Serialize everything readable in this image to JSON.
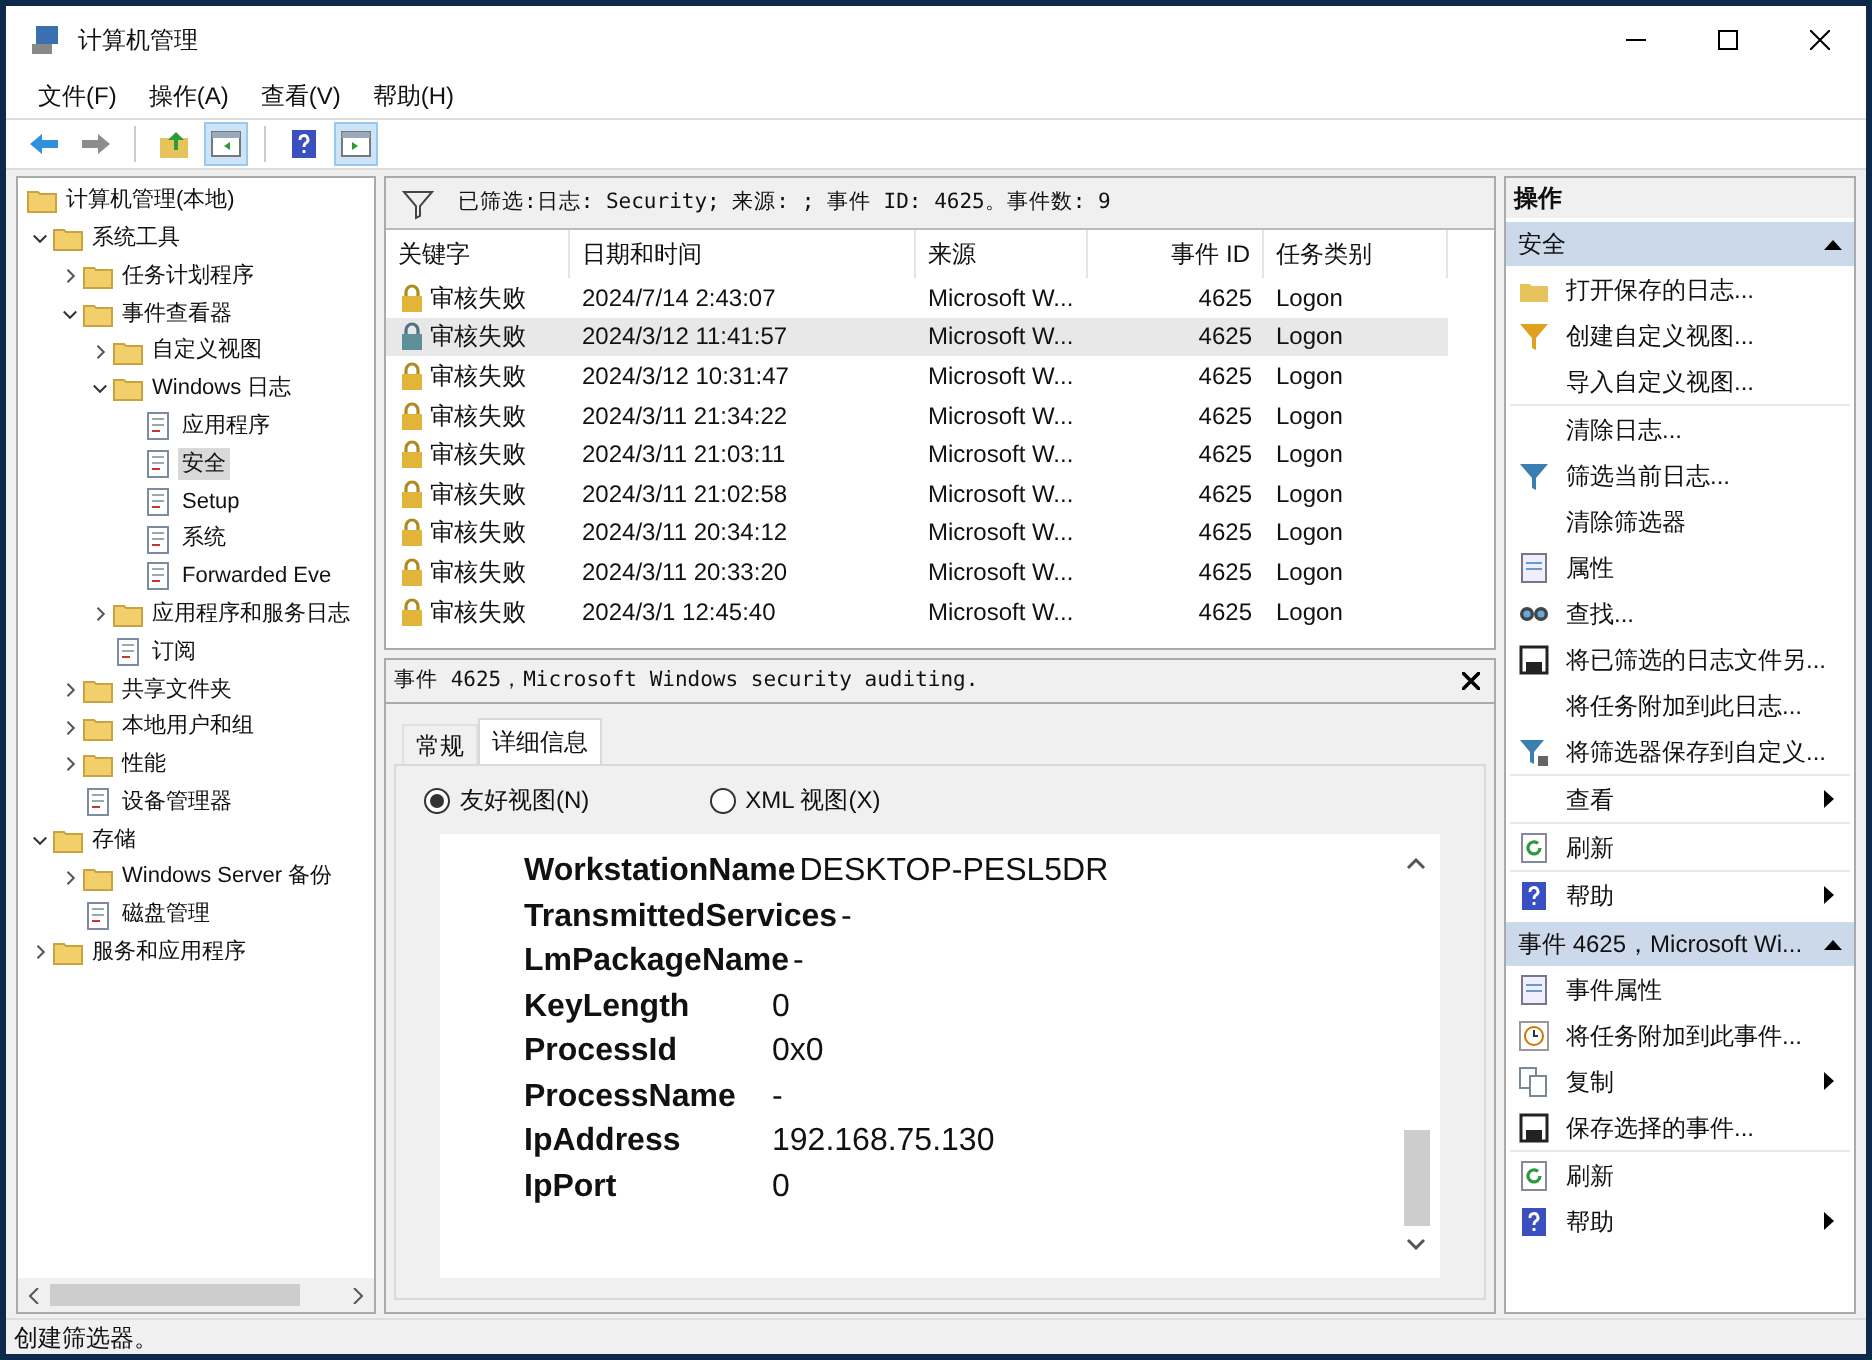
{
  "window": {
    "title": "计算机管理"
  },
  "menu": [
    "文件(F)",
    "操作(A)",
    "查看(V)",
    "帮助(H)"
  ],
  "toolbar": [
    {
      "pressed": false
    },
    {
      "pressed": false
    },
    {
      "pressed": false
    },
    {
      "pressed": true
    },
    {
      "pressed": false
    },
    {
      "pressed": true
    }
  ],
  "tree": [
    {
      "label": "计算机管理(本地)",
      "selected": false,
      "children": [
        {
          "label": "系统工具",
          "selected": false,
          "expanded": true,
          "children": [
            {
              "label": "任务计划程序",
              "selected": false,
              "expanded": false
            },
            {
              "label": "事件查看器",
              "selected": false,
              "expanded": true,
              "children": [
                {
                  "label": "自定义视图",
                  "selected": false,
                  "expanded": false
                },
                {
                  "label": "Windows 日志",
                  "selected": false,
                  "expanded": true,
                  "children": [
                    {
                      "label": "应用程序",
                      "selected": false
                    },
                    {
                      "label": "安全",
                      "selected": true
                    },
                    {
                      "label": "Setup",
                      "selected": false
                    },
                    {
                      "label": "系统",
                      "selected": false
                    },
                    {
                      "label": "Forwarded Eve",
                      "selected": false
                    }
                  ]
                },
                {
                  "label": "应用程序和服务日志",
                  "selected": false,
                  "expanded": false
                },
                {
                  "label": "订阅",
                  "selected": false
                }
              ]
            },
            {
              "label": "共享文件夹",
              "selected": false,
              "expanded": false
            },
            {
              "label": "本地用户和组",
              "selected": false,
              "expanded": false
            },
            {
              "label": "性能",
              "selected": false,
              "expanded": false
            },
            {
              "label": "设备管理器",
              "selected": false
            }
          ]
        },
        {
          "label": "存储",
          "selected": false,
          "expanded": true,
          "children": [
            {
              "label": "Windows Server 备份",
              "selected": false,
              "expanded": false
            },
            {
              "label": "磁盘管理",
              "selected": false
            }
          ]
        },
        {
          "label": "服务和应用程序",
          "selected": false,
          "expanded": false
        }
      ]
    }
  ],
  "filter_bar": "已筛选:日志: Security; 来源: ; 事件 ID: 4625。事件数: 9",
  "table": {
    "columns": [
      "关键字",
      "日期和时间",
      "来源",
      "事件 ID",
      "任务类别"
    ],
    "rows": [
      {
        "keyword": "审核失败",
        "datetime": "2024/7/14 2:43:07",
        "source": "Microsoft W...",
        "event_id": "4625",
        "category": "Logon",
        "selected": false
      },
      {
        "keyword": "审核失败",
        "datetime": "2024/3/12 11:41:57",
        "source": "Microsoft W...",
        "event_id": "4625",
        "category": "Logon",
        "selected": true
      },
      {
        "keyword": "审核失败",
        "datetime": "2024/3/12 10:31:47",
        "source": "Microsoft W...",
        "event_id": "4625",
        "category": "Logon",
        "selected": false
      },
      {
        "keyword": "审核失败",
        "datetime": "2024/3/11 21:34:22",
        "source": "Microsoft W...",
        "event_id": "4625",
        "category": "Logon",
        "selected": false
      },
      {
        "keyword": "审核失败",
        "datetime": "2024/3/11 21:03:11",
        "source": "Microsoft W...",
        "event_id": "4625",
        "category": "Logon",
        "selected": false
      },
      {
        "keyword": "审核失败",
        "datetime": "2024/3/11 21:02:58",
        "source": "Microsoft W...",
        "event_id": "4625",
        "category": "Logon",
        "selected": false
      },
      {
        "keyword": "审核失败",
        "datetime": "2024/3/11 20:34:12",
        "source": "Microsoft W...",
        "event_id": "4625",
        "category": "Logon",
        "selected": false
      },
      {
        "keyword": "审核失败",
        "datetime": "2024/3/11 20:33:20",
        "source": "Microsoft W...",
        "event_id": "4625",
        "category": "Logon",
        "selected": false
      },
      {
        "keyword": "审核失败",
        "datetime": "2024/3/1 12:45:40",
        "source": "Microsoft W...",
        "event_id": "4625",
        "category": "Logon",
        "selected": false
      }
    ]
  },
  "details": {
    "title": "事件 4625，Microsoft Windows security auditing.",
    "tabs": [
      {
        "label": "常规",
        "selected": false
      },
      {
        "label": "详细信息",
        "selected": true
      }
    ],
    "views": [
      {
        "label": "友好视图(N)",
        "selected": true
      },
      {
        "label": "XML 视图(X)",
        "selected": false
      }
    ],
    "fields": [
      {
        "name": "WorkstationName",
        "value": "DESKTOP-PESL5DR"
      },
      {
        "name": "TransmittedServices",
        "value": "-"
      },
      {
        "name": "LmPackageName",
        "value": "-"
      },
      {
        "name": "KeyLength",
        "value": "0"
      },
      {
        "name": "ProcessId",
        "value": "0x0"
      },
      {
        "name": "ProcessName",
        "value": "-"
      },
      {
        "name": "IpAddress",
        "value": "192.168.75.130"
      },
      {
        "name": "IpPort",
        "value": "0"
      }
    ]
  },
  "actions": {
    "title": "操作",
    "sections": [
      {
        "title": "安全",
        "expanded": true,
        "groups": [
          [
            {
              "label": "打开保存的日志...",
              "submenu": false
            },
            {
              "label": "创建自定义视图...",
              "submenu": false
            },
            {
              "label": "导入自定义视图...",
              "submenu": false
            }
          ],
          [
            {
              "label": "清除日志...",
              "submenu": false
            },
            {
              "label": "筛选当前日志...",
              "submenu": false
            },
            {
              "label": "清除筛选器",
              "submenu": false
            },
            {
              "label": "属性",
              "submenu": false
            },
            {
              "label": "查找...",
              "submenu": false
            },
            {
              "label": "将已筛选的日志文件另...",
              "submenu": false
            },
            {
              "label": "将任务附加到此日志...",
              "submenu": false
            },
            {
              "label": "将筛选器保存到自定义...",
              "submenu": false
            }
          ],
          [
            {
              "label": "查看",
              "submenu": true
            }
          ],
          [
            {
              "label": "刷新",
              "submenu": false
            }
          ],
          [
            {
              "label": "帮助",
              "submenu": true
            }
          ]
        ]
      },
      {
        "title": "事件 4625，Microsoft Wi...",
        "expanded": true,
        "groups": [
          [
            {
              "label": "事件属性",
              "submenu": false
            },
            {
              "label": "将任务附加到此事件...",
              "submenu": false
            },
            {
              "label": "复制",
              "submenu": true
            },
            {
              "label": "保存选择的事件...",
              "submenu": false
            }
          ],
          [
            {
              "label": "刷新",
              "submenu": false
            },
            {
              "label": "帮助",
              "submenu": true
            }
          ]
        ]
      }
    ]
  },
  "status_bar": "创建筛选器。"
}
